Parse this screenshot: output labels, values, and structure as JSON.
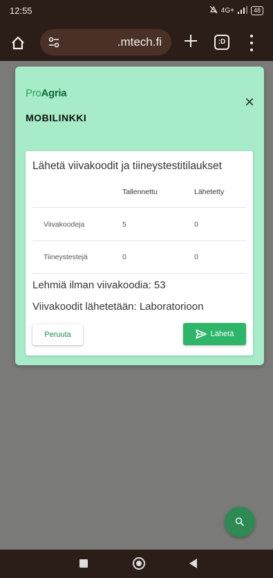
{
  "status_bar": {
    "time": "12:55",
    "network": "4G+",
    "battery": "48"
  },
  "browser": {
    "url": ".mtech.fi",
    "tabs_count": ":D"
  },
  "dialog": {
    "logo_pro": "Pro",
    "logo_agria": "Agria",
    "title": "MOBILINKKI",
    "close_label": "×",
    "card": {
      "title": "Lähetä viivakoodit ja tiineystestitilaukset",
      "headers": {
        "saved": "Tallennettu",
        "sent": "Lähetetty"
      },
      "rows": [
        {
          "label": "Viivakoodeja",
          "saved": "5",
          "sent": "0"
        },
        {
          "label": "Tiineystestejä",
          "saved": "0",
          "sent": "0"
        }
      ],
      "cows_without_barcode": "Lehmiä ilman viivakoodia: 53",
      "barcodes_sent_to": "Viivakoodit lähetetään: Laboratorioon",
      "cancel_label": "Peruuta",
      "send_label": "Lähetä"
    }
  },
  "colors": {
    "accent": "#2fb56a",
    "dialog_bg": "#a8ebc8",
    "overlay": "#7a7a79",
    "fab": "#2e8a52"
  },
  "icons": {
    "fab": "search-icon",
    "send": "send-icon"
  }
}
